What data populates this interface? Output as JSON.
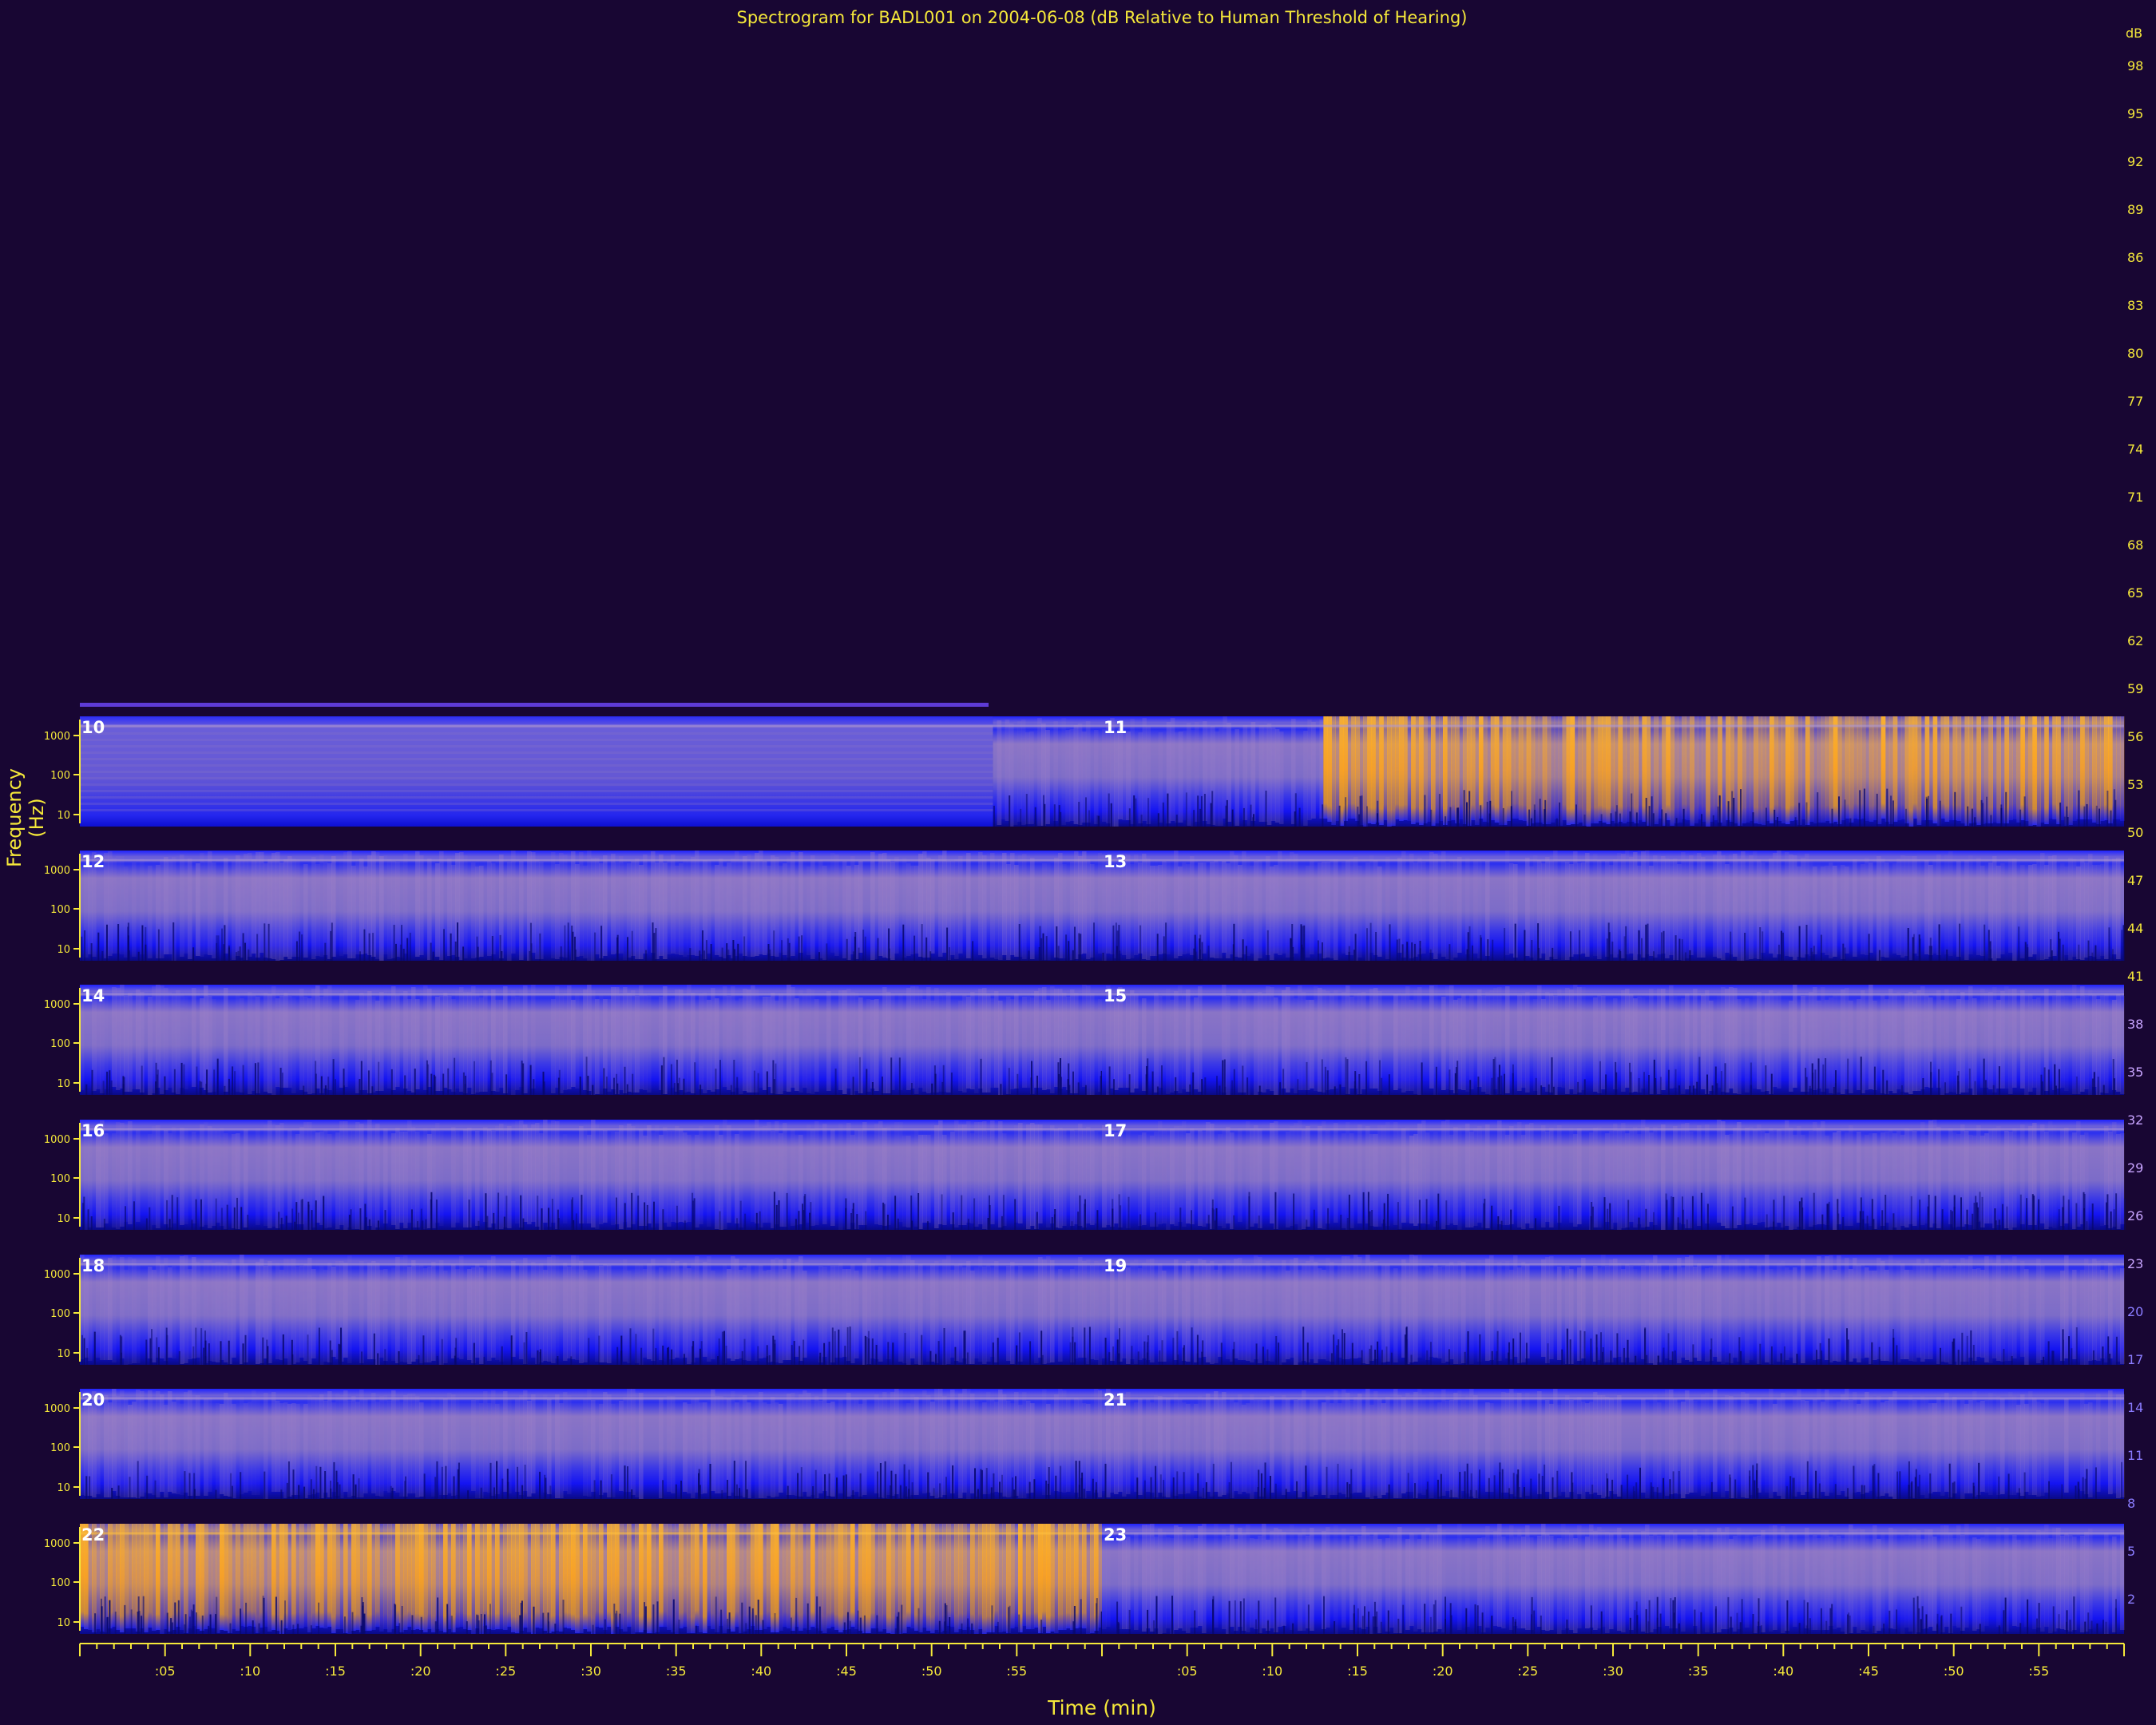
{
  "chart_data": {
    "type": "heatmap",
    "title": "Spectrogram for BADL001 on 2004-06-08 (dB Relative to Human Threshold of Hearing)",
    "xlabel": "Time (min)",
    "ylabel": "Frequency (Hz)",
    "x_tick_labels": [
      ":05",
      ":10",
      ":15",
      ":20",
      ":25",
      ":30",
      ":35",
      ":40",
      ":45",
      ":50",
      ":55"
    ],
    "y_tick_labels": [
      "1000",
      "100",
      "10"
    ],
    "colorbar": {
      "unit": "dB",
      "ticks": [
        98,
        95,
        92,
        89,
        86,
        83,
        80,
        77,
        74,
        71,
        68,
        65,
        62,
        59,
        56,
        53,
        50,
        47,
        44,
        41,
        38,
        35,
        32,
        29,
        26,
        23,
        20,
        17,
        14,
        11,
        8,
        5,
        2
      ]
    },
    "colors": {
      "background": "#180633",
      "axis": "#f5e83a",
      "low": "#0a0cff",
      "mid": "#8a74c6",
      "high": "#ffa41c"
    },
    "panels": [
      {
        "hour": "10",
        "intensity": 0.55,
        "data_start_min": 53.6
      },
      {
        "hour": "11",
        "intensity": 0.5,
        "loud_from_min": 13,
        "loud_intensity": 0.95
      },
      {
        "hour": "12",
        "intensity": 0.55
      },
      {
        "hour": "13",
        "intensity": 0.5
      },
      {
        "hour": "14",
        "intensity": 0.55
      },
      {
        "hour": "15",
        "intensity": 0.55
      },
      {
        "hour": "16",
        "intensity": 0.5
      },
      {
        "hour": "17",
        "intensity": 0.5
      },
      {
        "hour": "18",
        "intensity": 0.5
      },
      {
        "hour": "19",
        "intensity": 0.5
      },
      {
        "hour": "20",
        "intensity": 0.5
      },
      {
        "hour": "21",
        "intensity": 0.5
      },
      {
        "hour": "22",
        "intensity": 0.92
      },
      {
        "hour": "23",
        "intensity": 0.5
      }
    ]
  }
}
